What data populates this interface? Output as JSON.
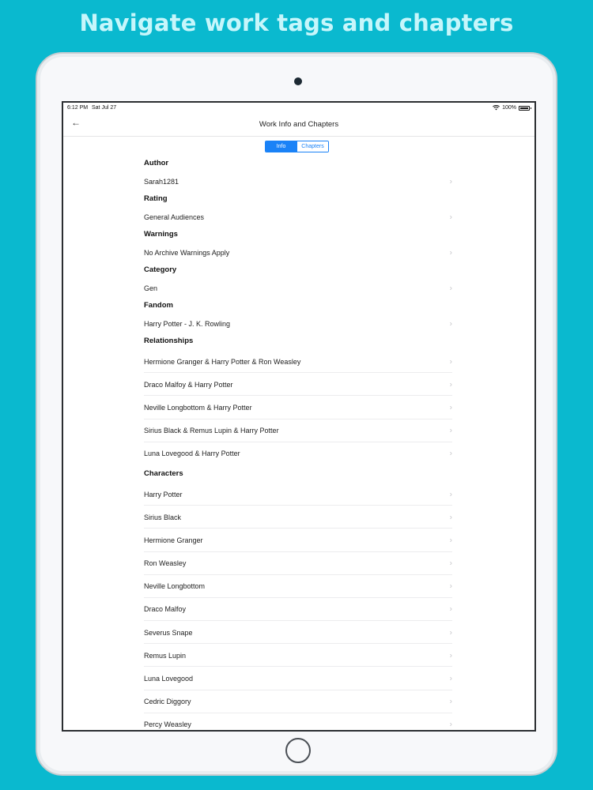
{
  "banner": {
    "title": "Navigate work tags and chapters"
  },
  "status_bar": {
    "time": "6:12 PM",
    "date": "Sat Jul 27",
    "battery": "100%"
  },
  "nav": {
    "back_icon": "back-arrow-icon",
    "title": "Work Info and Chapters"
  },
  "segments": {
    "info": "Info",
    "chapters": "Chapters",
    "selected": "Info"
  },
  "colors": {
    "background": "#0ab9cf",
    "accent": "#1a82f7"
  },
  "sections": {
    "author": {
      "header": "Author",
      "items": [
        "Sarah1281"
      ]
    },
    "rating": {
      "header": "Rating",
      "items": [
        "General Audiences"
      ]
    },
    "warnings": {
      "header": "Warnings",
      "items": [
        "No Archive Warnings Apply"
      ]
    },
    "category": {
      "header": "Category",
      "items": [
        "Gen"
      ]
    },
    "fandom": {
      "header": "Fandom",
      "items": [
        "Harry Potter - J. K. Rowling"
      ]
    },
    "relationships": {
      "header": "Relationships",
      "items": [
        "Hermione Granger & Harry Potter & Ron Weasley",
        "Draco Malfoy & Harry Potter",
        "Neville Longbottom & Harry Potter",
        "Sirius Black & Remus Lupin & Harry Potter",
        "Luna Lovegood & Harry Potter"
      ]
    },
    "characters": {
      "header": "Characters",
      "items": [
        "Harry Potter",
        "Sirius Black",
        "Hermione Granger",
        "Ron Weasley",
        "Neville Longbottom",
        "Draco Malfoy",
        "Severus Snape",
        "Remus Lupin",
        "Luna Lovegood",
        "Cedric Diggory",
        "Percy Weasley"
      ]
    }
  }
}
